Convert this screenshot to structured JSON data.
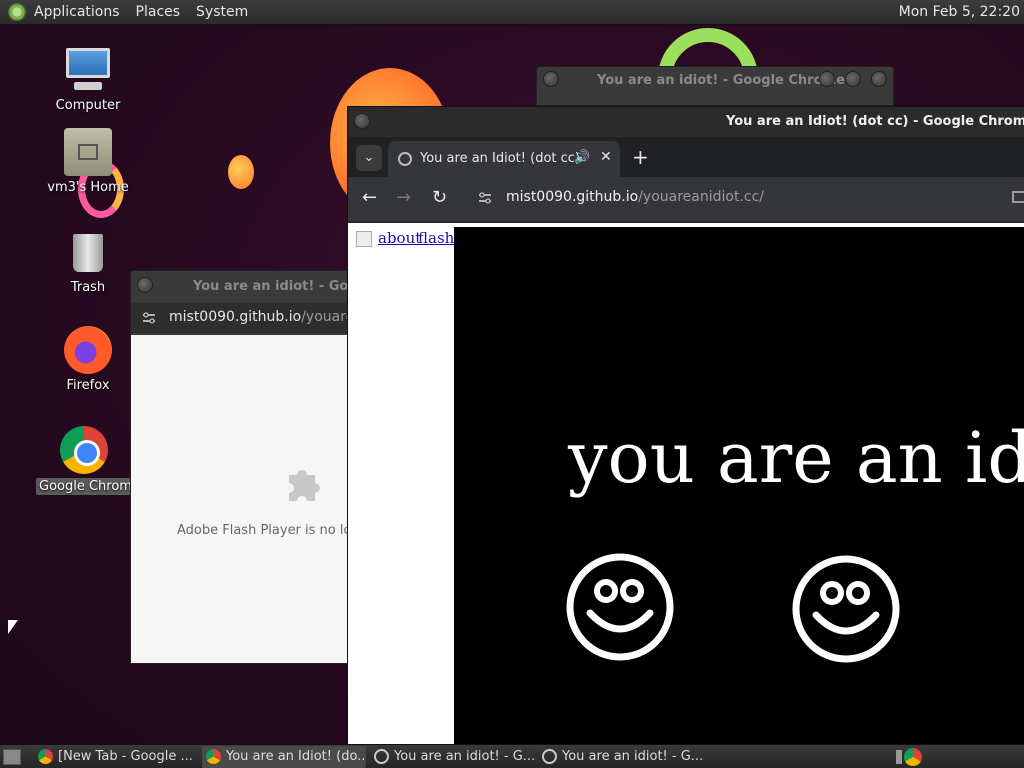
{
  "top_panel": {
    "menu": [
      "Applications",
      "Places",
      "System"
    ],
    "clock": "Mon Feb  5, 22:20"
  },
  "desktop_icons": [
    {
      "label": "Computer",
      "icon": "computer-icon"
    },
    {
      "label": "vm3's Home",
      "icon": "home-folder-icon"
    },
    {
      "label": "Trash",
      "icon": "trash-icon"
    },
    {
      "label": "Firefox",
      "icon": "firefox-icon"
    },
    {
      "label": "Google Chrome",
      "icon": "chrome-icon"
    }
  ],
  "back_window_3": {
    "title": "You are an idiot! - Google Chrome"
  },
  "back_window_2": {
    "title": "You are an idiot! - Google Chrome",
    "url_host": "mist0090.github.io",
    "url_path": "/youareanidiot.cc/",
    "plugin_message": "Adobe Flash Player is no longer supported"
  },
  "front_window": {
    "title": "You are an Idiot! (dot cc) - Google Chrome",
    "tab_title": "You are an Idiot! (dot cc)",
    "url_host": "mist0090.github.io",
    "url_path": "/youareanidiot.cc/",
    "links": [
      "about",
      "flash"
    ],
    "banner_text": "you are an idiot!"
  },
  "taskbar": {
    "tasks": [
      {
        "label": "[New Tab - Google ...",
        "active": false
      },
      {
        "label": "You are an Idiot! (do...",
        "active": true
      },
      {
        "label": "You are an idiot! - G...",
        "active": false
      },
      {
        "label": "You are an idiot! - G...",
        "active": false
      }
    ]
  },
  "colors": {
    "desktop_bg": "#2a0a22",
    "panel_bg": "#2b2b2b",
    "link": "#1a0dab"
  }
}
